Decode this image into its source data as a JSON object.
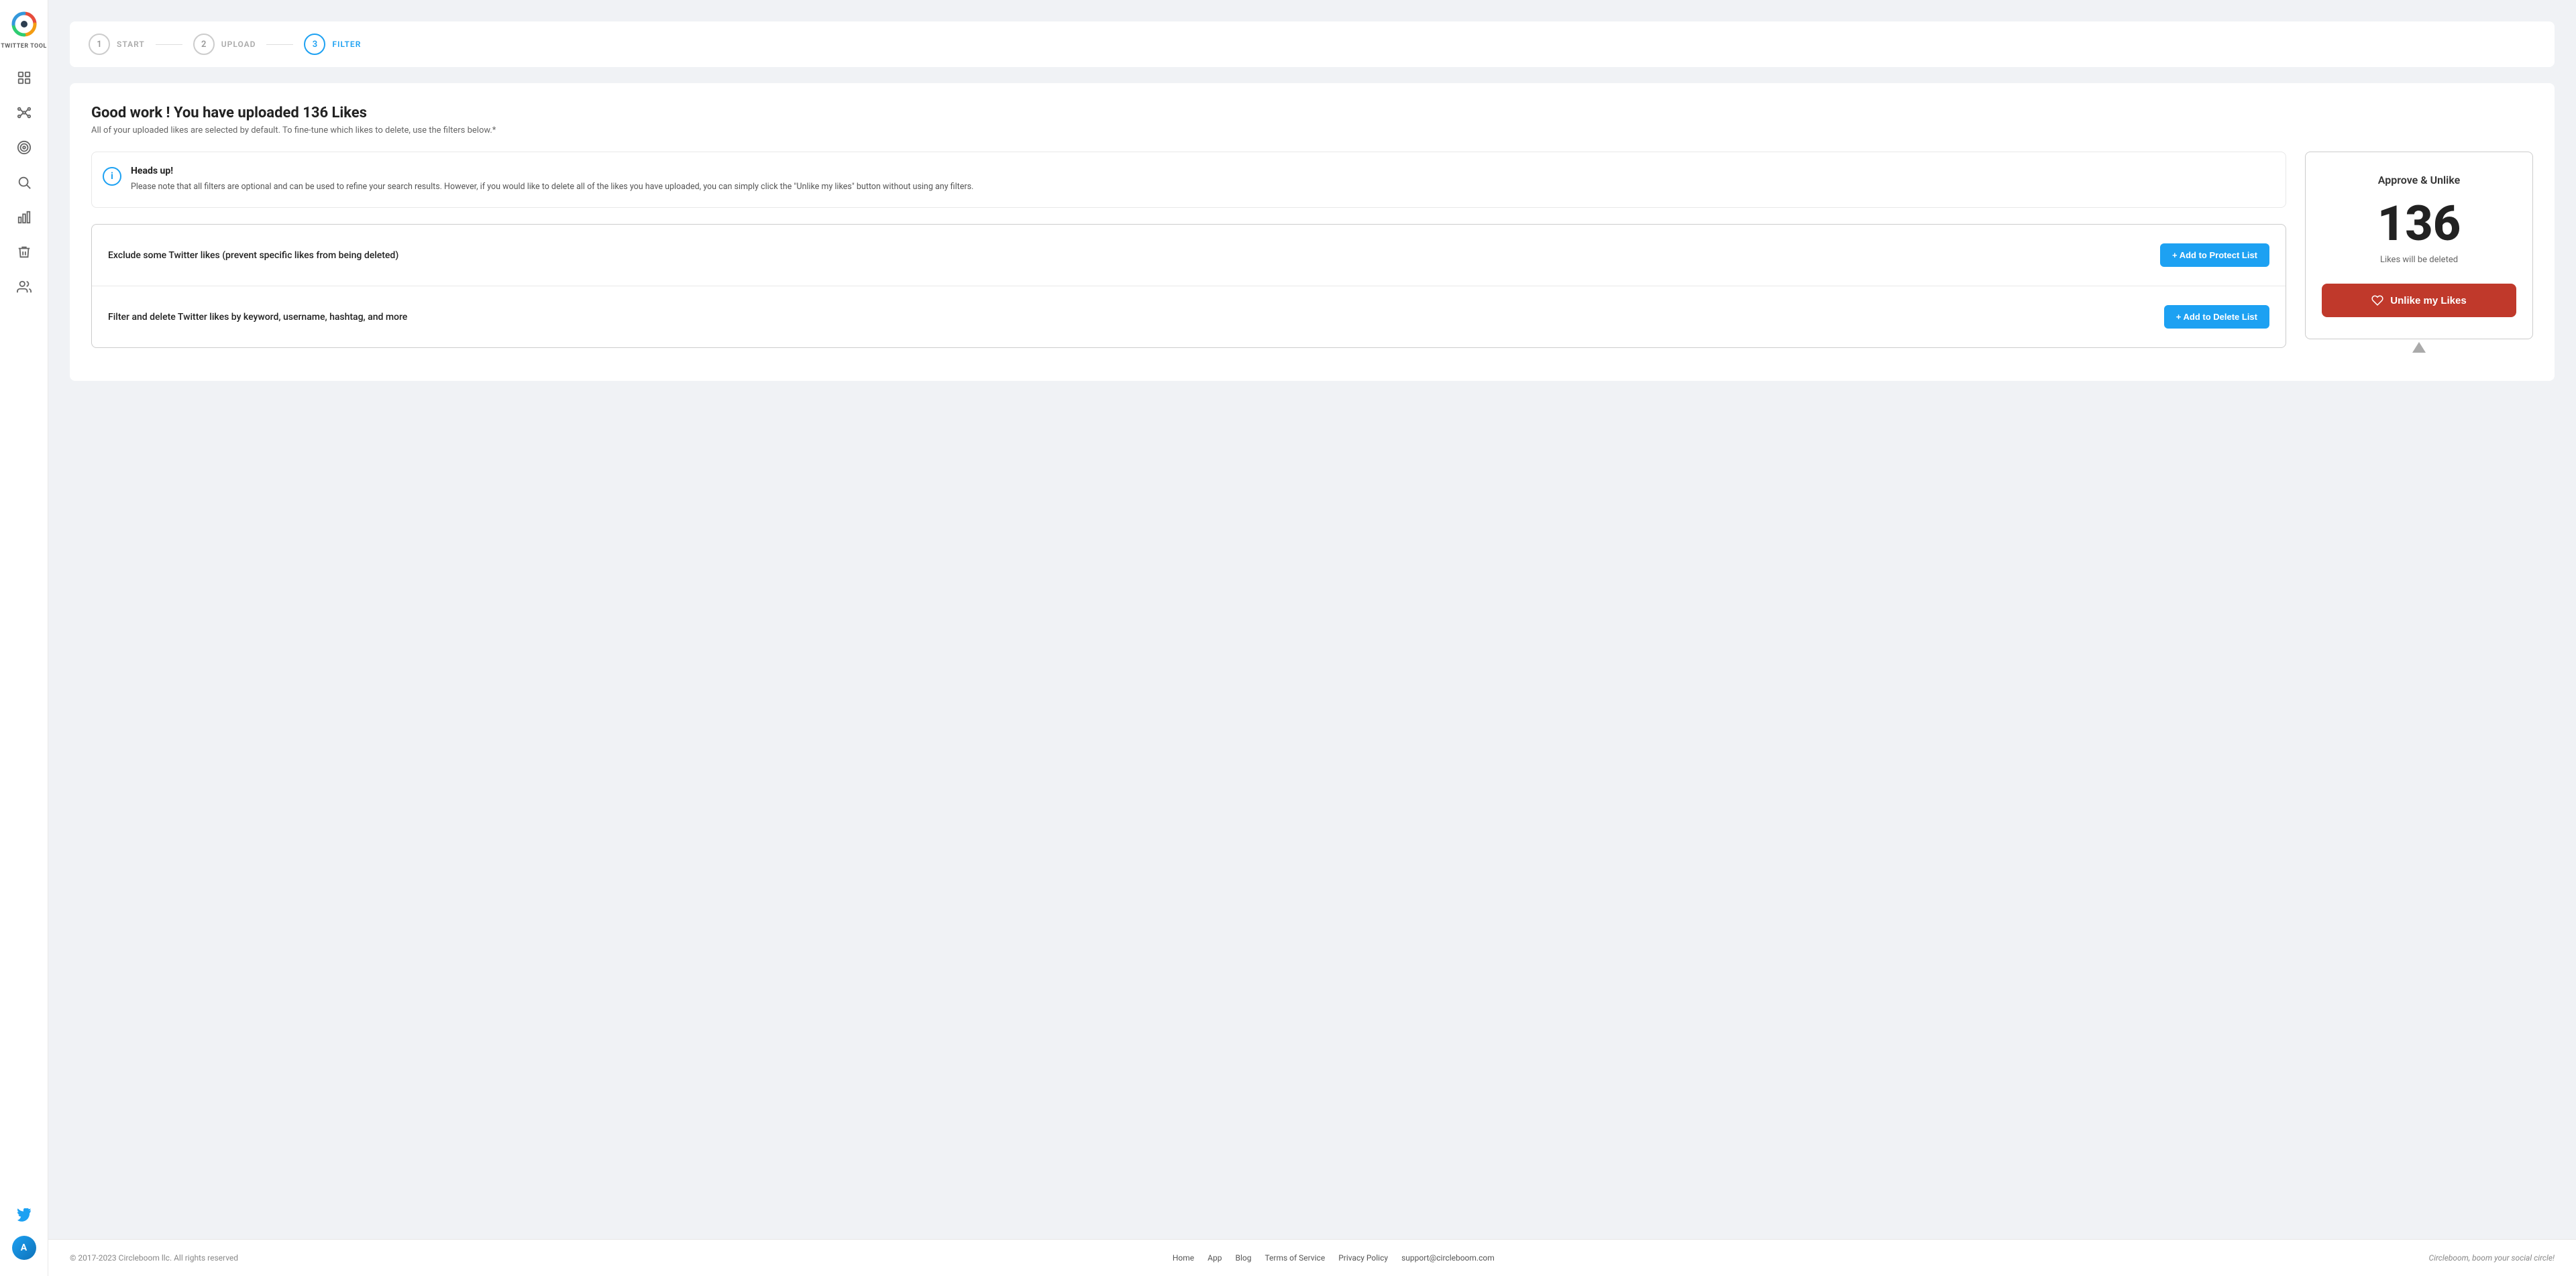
{
  "sidebar": {
    "logo_text": "TWITTER TOOL",
    "nav_items": [
      {
        "id": "dashboard",
        "icon": "grid",
        "label": "Dashboard"
      },
      {
        "id": "network",
        "icon": "network",
        "label": "Network"
      },
      {
        "id": "target",
        "icon": "target",
        "label": "Target"
      },
      {
        "id": "search",
        "icon": "search",
        "label": "Search"
      },
      {
        "id": "analytics",
        "icon": "bar-chart",
        "label": "Analytics"
      },
      {
        "id": "delete",
        "icon": "trash",
        "label": "Delete"
      },
      {
        "id": "users",
        "icon": "users",
        "label": "Users"
      }
    ],
    "twitter_icon": "twitter",
    "avatar_text": "A"
  },
  "stepper": {
    "steps": [
      {
        "number": "1",
        "label": "START",
        "active": false
      },
      {
        "number": "2",
        "label": "UPLOAD",
        "active": false
      },
      {
        "number": "3",
        "label": "FILTER",
        "active": true
      }
    ]
  },
  "main": {
    "title": "Good work ! You have uploaded 136 Likes",
    "subtitle": "All of your uploaded likes are selected by default. To fine-tune which likes to delete, use the filters below.*",
    "alert": {
      "title": "Heads up!",
      "text": "Please note that all filters are optional and can be used to refine your search results. However, if you would like to delete all of the likes you have uploaded, you can simply click the \"Unlike my likes\" button without using any filters."
    },
    "filters": [
      {
        "label": "Exclude some Twitter likes (prevent specific likes from being deleted)",
        "button": "+ Add to Protect List"
      },
      {
        "label": "Filter and delete Twitter likes by keyword, username, hashtag, and more",
        "button": "+ Add to Delete List"
      }
    ]
  },
  "approve_panel": {
    "title": "Approve & Unlike",
    "count": "136",
    "subtitle": "Likes will be deleted",
    "button_label": "Unlike my Likes"
  },
  "footer": {
    "copyright": "© 2017-2023 Circleboom llc. All rights reserved",
    "links": [
      "Home",
      "App",
      "Blog",
      "Terms of Service",
      "Privacy Policy",
      "support@circleboom.com"
    ],
    "tagline": "Circleboom, boom your social circle!"
  }
}
